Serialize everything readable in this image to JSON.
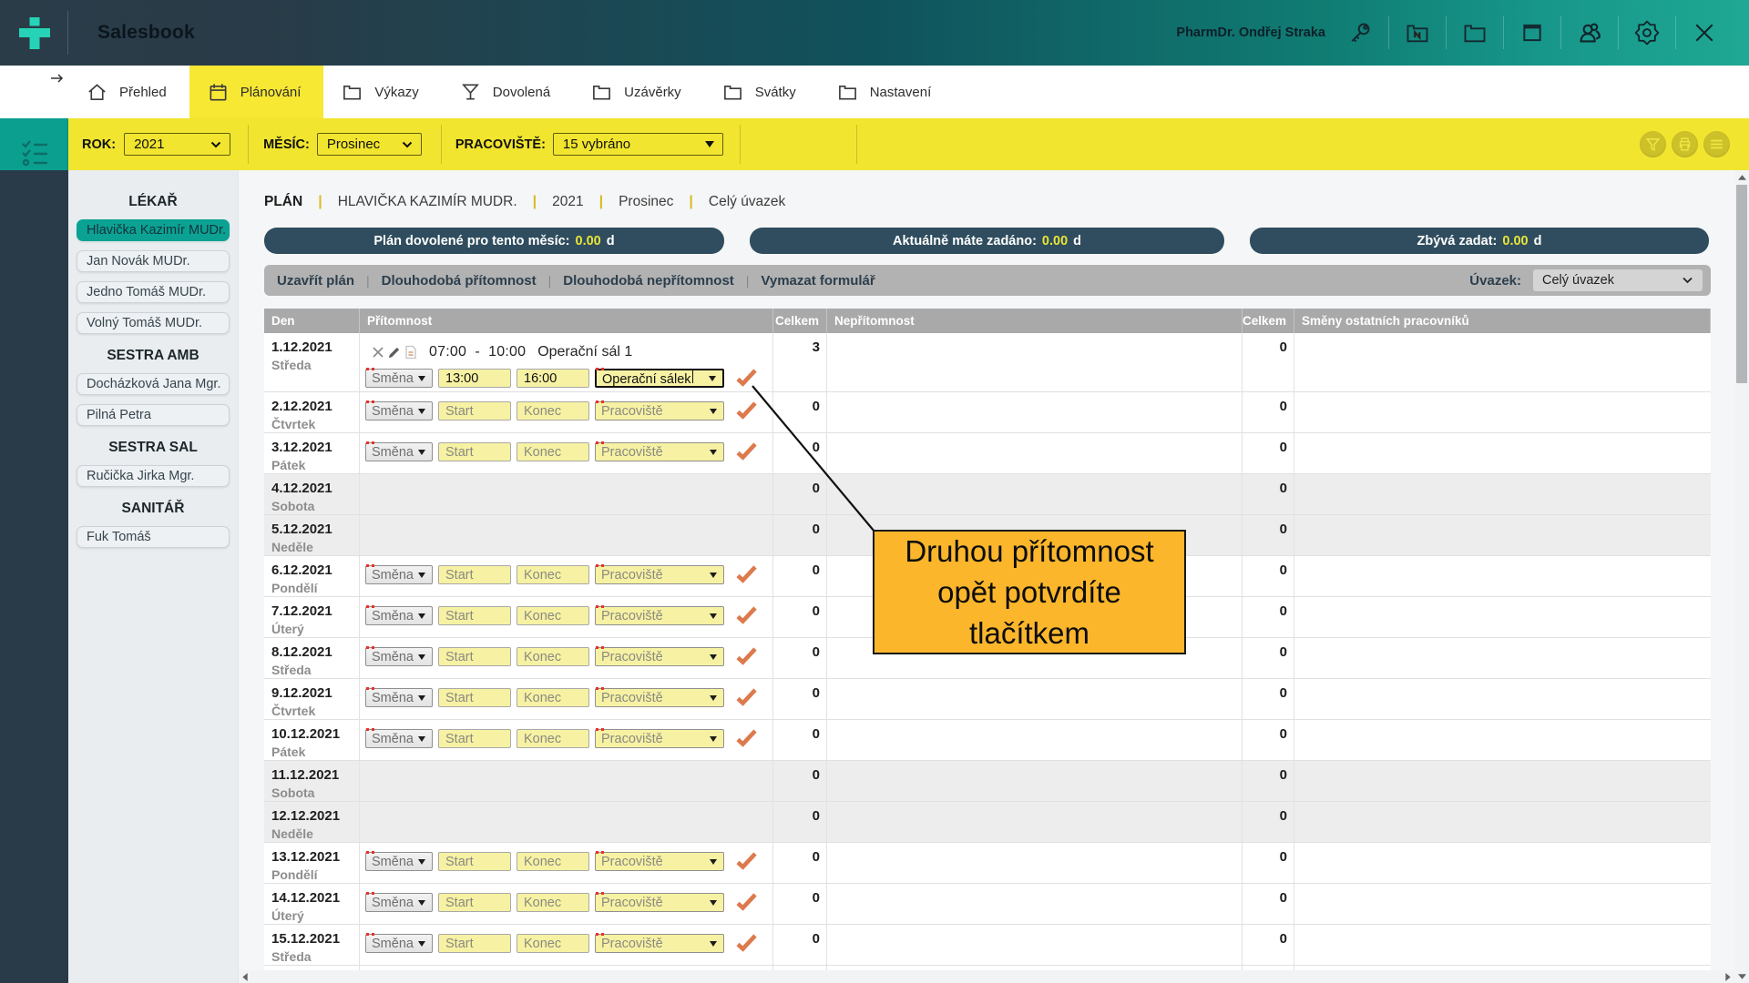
{
  "topbar": {
    "title": "Salesbook",
    "user": "PharmDr. Ondřej Straka"
  },
  "nav": {
    "tabs": [
      {
        "label": "Přehled",
        "icon": "home-icon",
        "active": false
      },
      {
        "label": "Plánování",
        "icon": "calendar-icon",
        "active": true
      },
      {
        "label": "Výkazy",
        "icon": "folder-icon",
        "active": false
      },
      {
        "label": "Dovolená",
        "icon": "cocktail-icon",
        "active": false
      },
      {
        "label": "Uzávěrky",
        "icon": "folder-icon",
        "active": false
      },
      {
        "label": "Svátky",
        "icon": "folder-icon",
        "active": false
      },
      {
        "label": "Nastavení",
        "icon": "folder-icon",
        "active": false
      }
    ]
  },
  "filters": {
    "rok_label": "ROK:",
    "rok_value": "2021",
    "mesic_label": "MĚSÍC:",
    "mesic_value": "Prosinec",
    "prac_label": "PRACOVIŠTĚ:",
    "prac_value": "15 vybráno"
  },
  "sidebar": {
    "groups": [
      {
        "title": "LÉKAŘ",
        "items": [
          {
            "label": "Hlavička Kazimír MUDr.",
            "selected": true
          },
          {
            "label": "Jan Novák MUDr.",
            "selected": false
          },
          {
            "label": "Jedno Tomáš MUDr.",
            "selected": false
          },
          {
            "label": "Volný Tomáš MUDr.",
            "selected": false
          }
        ]
      },
      {
        "title": "SESTRA AMB",
        "items": [
          {
            "label": "Docházková Jana Mgr.",
            "selected": false
          },
          {
            "label": "Pilná Petra",
            "selected": false
          }
        ]
      },
      {
        "title": "SESTRA SAL",
        "items": [
          {
            "label": "Ručička Jirka Mgr.",
            "selected": false
          }
        ]
      },
      {
        "title": "SANITÁŘ",
        "items": [
          {
            "label": "Fuk Tomáš",
            "selected": false
          }
        ]
      }
    ]
  },
  "breadcrumb": {
    "root": "PLÁN",
    "items": [
      "HLAVIČKA KAZIMÍR MUDR.",
      "2021",
      "Prosinec",
      "Celý úvazek"
    ]
  },
  "summary_pills": [
    {
      "label": "Plán dovolené pro tento měsíc:",
      "value": "0.00",
      "unit": "d"
    },
    {
      "label": "Aktuálně máte zadáno:",
      "value": "0.00",
      "unit": "d"
    },
    {
      "label": "Zbývá zadat:",
      "value": "0.00",
      "unit": "d"
    }
  ],
  "toolbar": {
    "actions": [
      "Uzavřít plán",
      "Dlouhodobá přítomnost",
      "Dlouhodobá nepřítomnost",
      "Vymazat formulář"
    ],
    "uvazek_label": "Úvazek:",
    "uvazek_value": "Celý úvazek"
  },
  "table": {
    "headers": [
      "Den",
      "Přítomnost",
      "Celkem",
      "Nepřítomnost",
      "Celkem",
      "Směny ostatních pracovníků"
    ],
    "placeholders": {
      "smena": "Směna",
      "start": "Start",
      "konec": "Konec",
      "pracoviste": "Pracoviště"
    },
    "rows": [
      {
        "date": "1.12.2021",
        "weekday": "Středa",
        "weekend": false,
        "celkem1": "3",
        "celkem2": "0",
        "entry": {
          "time": "07:00  -  10:00",
          "place": "Operační sál 1"
        },
        "form": {
          "smena": "Směna",
          "start": "13:00",
          "konec": "16:00",
          "pracoviste": "Operační sálek",
          "filled": true,
          "focused": true
        }
      },
      {
        "date": "2.12.2021",
        "weekday": "Čtvrtek",
        "weekend": false,
        "celkem1": "0",
        "celkem2": "0",
        "form": {}
      },
      {
        "date": "3.12.2021",
        "weekday": "Pátek",
        "weekend": false,
        "celkem1": "0",
        "celkem2": "0",
        "form": {}
      },
      {
        "date": "4.12.2021",
        "weekday": "Sobota",
        "weekend": true,
        "celkem1": "0",
        "celkem2": "0"
      },
      {
        "date": "5.12.2021",
        "weekday": "Neděle",
        "weekend": true,
        "celkem1": "0",
        "celkem2": "0"
      },
      {
        "date": "6.12.2021",
        "weekday": "Pondělí",
        "weekend": false,
        "celkem1": "0",
        "celkem2": "0",
        "form": {}
      },
      {
        "date": "7.12.2021",
        "weekday": "Úterý",
        "weekend": false,
        "celkem1": "0",
        "celkem2": "0",
        "form": {}
      },
      {
        "date": "8.12.2021",
        "weekday": "Středa",
        "weekend": false,
        "celkem1": "0",
        "celkem2": "0",
        "form": {}
      },
      {
        "date": "9.12.2021",
        "weekday": "Čtvrtek",
        "weekend": false,
        "celkem1": "0",
        "celkem2": "0",
        "form": {}
      },
      {
        "date": "10.12.2021",
        "weekday": "Pátek",
        "weekend": false,
        "celkem1": "0",
        "celkem2": "0",
        "form": {}
      },
      {
        "date": "11.12.2021",
        "weekday": "Sobota",
        "weekend": true,
        "celkem1": "0",
        "celkem2": "0"
      },
      {
        "date": "12.12.2021",
        "weekday": "Neděle",
        "weekend": true,
        "celkem1": "0",
        "celkem2": "0"
      },
      {
        "date": "13.12.2021",
        "weekday": "Pondělí",
        "weekend": false,
        "celkem1": "0",
        "celkem2": "0",
        "form": {}
      },
      {
        "date": "14.12.2021",
        "weekday": "Úterý",
        "weekend": false,
        "celkem1": "0",
        "celkem2": "0",
        "form": {}
      },
      {
        "date": "15.12.2021",
        "weekday": "Středa",
        "weekend": false,
        "celkem1": "0",
        "celkem2": "0",
        "form": {}
      }
    ]
  },
  "annotation": {
    "lines": [
      "Druhou přítomnost",
      "opět potvrdíte",
      "tlačítkem"
    ]
  },
  "colors": {
    "brand_teal": "#26d3b6",
    "topbar_left": "#2b3c49",
    "topbar_right": "#21a78f",
    "accent_yellow": "#f1e52f",
    "tab_yellow": "#f7e833",
    "selected_teal": "#0ba294",
    "pill_navy": "#2f4d5e",
    "pill_value_yellow": "#e8e438",
    "toolbar_gray": "#b2b2b2",
    "header_gray": "#a9a9a9",
    "input_yellow": "#f7f2a3",
    "required_red": "#e8312a",
    "confirm_orange": "#dd7a4d",
    "callout_orange": "#fbb62c",
    "weekend_gray": "#ededee"
  }
}
